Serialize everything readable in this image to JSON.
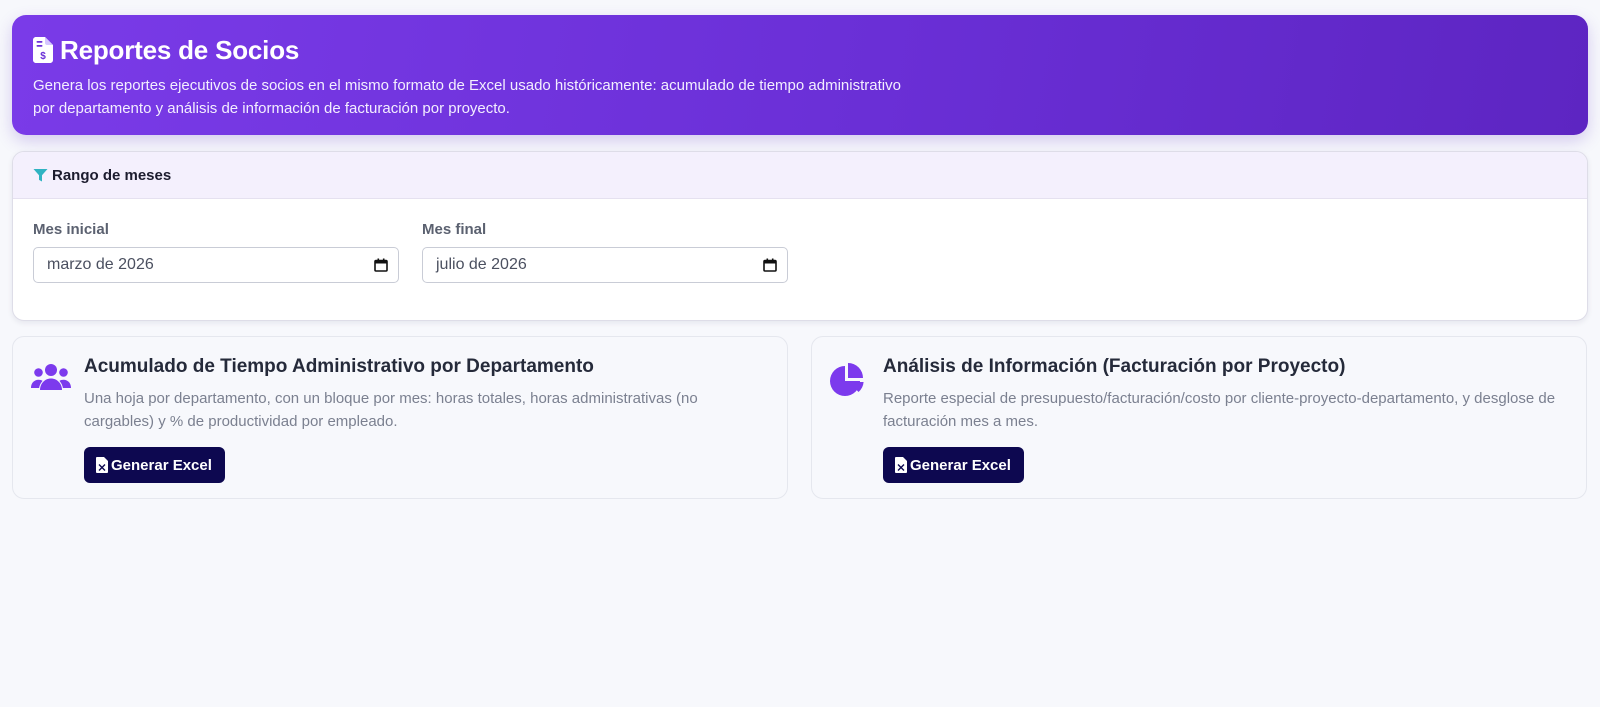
{
  "header": {
    "title": "Reportes de Socios",
    "description": "Genera los reportes ejecutivos de socios en el mismo formato de Excel usado históricamente: acumulado de tiempo administrativo por departamento y análisis de información de facturación por proyecto.",
    "icon": "file-invoice-dollar-icon"
  },
  "filters": {
    "title": "Rango de meses",
    "icon": "filter-icon",
    "start": {
      "label": "Mes inicial",
      "value": "marzo de 2026",
      "icon": "calendar-icon"
    },
    "end": {
      "label": "Mes final",
      "value": "julio de 2026",
      "icon": "calendar-icon"
    }
  },
  "reports": [
    {
      "title": "Acumulado de Tiempo Administrativo por Departamento",
      "description": "Una hoja por departamento, con un bloque por mes: horas totales, horas administrativas (no cargables) y % de productividad por empleado.",
      "button_label": "Generar Excel",
      "icon": "users-icon"
    },
    {
      "title": "Análisis de Información (Facturación por Proyecto)",
      "description": "Reporte especial de presupuesto/facturación/costo por cliente-proyecto-departamento, y desglose de facturación mes a mes.",
      "button_label": "Generar Excel",
      "icon": "chart-pie-icon"
    }
  ],
  "colors": {
    "header_gradient_start": "#7a3be8",
    "header_gradient_end": "#5d25c2",
    "accent_purple": "#7c3aed",
    "filter_icon": "#2fb3c2",
    "button_background": "#0d0850",
    "page_background": "#f7f8fc"
  }
}
